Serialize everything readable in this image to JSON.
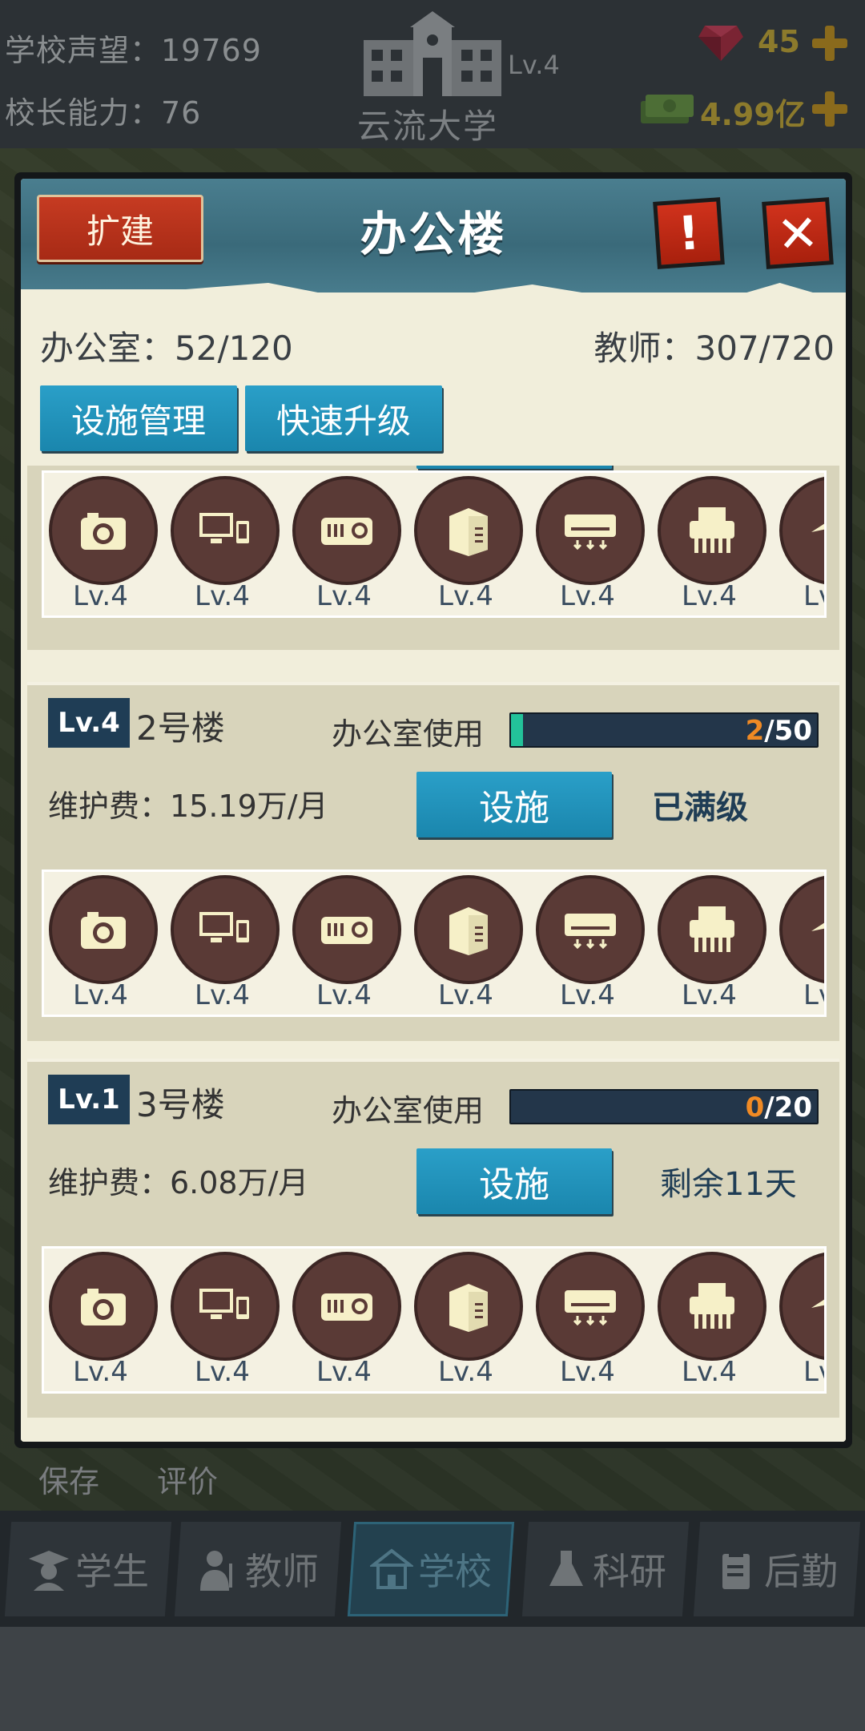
{
  "topbar": {
    "reputation": "学校声望：19769",
    "principal_ability": "校长能力：76",
    "school_level": "Lv.4",
    "school_name": "云流大学",
    "gems": "45",
    "cash": "4.99亿"
  },
  "dialog": {
    "title": "办公楼",
    "expand_label": "扩建",
    "offices_summary": "办公室：52/120",
    "teachers_summary": "教师：307/720",
    "facility_mgmt_label": "设施管理",
    "quick_upgrade_label": "快速升级"
  },
  "facility_icons": [
    "camera-icon",
    "computer-icon",
    "projector-icon",
    "server-icon",
    "air-conditioner-icon",
    "shredder-icon",
    "desk-lamp-icon"
  ],
  "buildings": [
    {
      "level": "Lv.4",
      "name": "2号楼",
      "usage_label": "办公室使用",
      "usage_current": "2",
      "usage_max": "/50",
      "usage_fraction": 0.04,
      "fee": "维护费：15.19万/月",
      "facility_label": "设施",
      "status": "已满级",
      "facilities": [
        "Lv.4",
        "Lv.4",
        "Lv.4",
        "Lv.4",
        "Lv.4",
        "Lv.4",
        "Lv"
      ]
    },
    {
      "level": "Lv.1",
      "name": "3号楼",
      "usage_label": "办公室使用",
      "usage_current": "0",
      "usage_max": "/20",
      "usage_fraction": 0.0,
      "fee": "维护费：6.08万/月",
      "facility_label": "设施",
      "status": "剩余11天",
      "facilities": [
        "Lv.4",
        "Lv.4",
        "Lv.4",
        "Lv.4",
        "Lv.4",
        "Lv.4",
        "Lv"
      ]
    }
  ],
  "top_partial_card": {
    "facilities": [
      "Lv.4",
      "Lv.4",
      "Lv.4",
      "Lv.4",
      "Lv.4",
      "Lv.4",
      "Lv"
    ]
  },
  "below_dialog": {
    "save_label": "保存",
    "rate_label": "评价"
  },
  "bottom_nav": [
    {
      "label": "学生",
      "icon": "student-icon"
    },
    {
      "label": "教师",
      "icon": "teacher-icon"
    },
    {
      "label": "学校",
      "icon": "school-icon"
    },
    {
      "label": "科研",
      "icon": "flask-icon"
    },
    {
      "label": "后勤",
      "icon": "clipboard-icon"
    }
  ],
  "colors": {
    "accent_blue": "#1a86ad",
    "expand_red": "#c63b22",
    "usage_current_orange": "#f08a24",
    "badge_navy": "#1f3d55"
  }
}
